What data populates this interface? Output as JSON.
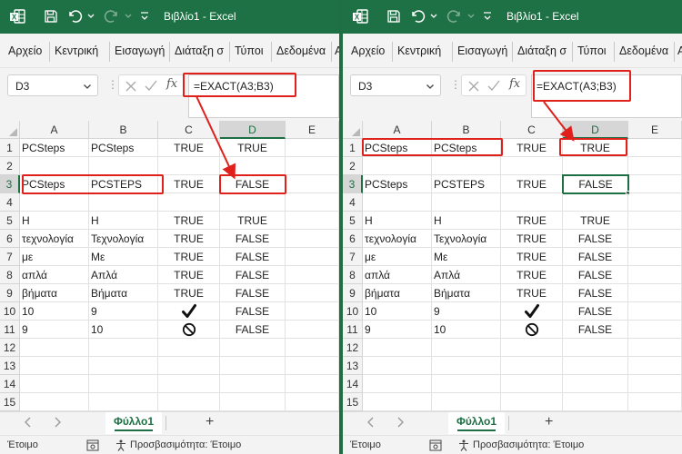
{
  "app": {
    "title": "Βιβλίο1  -  Excel",
    "tabs": [
      "Αρχείο",
      "Κεντρική",
      "Εισαγωγή",
      "Διάταξη σ",
      "Τύποι",
      "Δεδομένα",
      "Α"
    ],
    "name_box": "D3",
    "formula": "=EXACT(A3;B3)",
    "fx_label": "fx",
    "columns": [
      "A",
      "B",
      "C",
      "D",
      "E"
    ],
    "rows": [
      "1",
      "2",
      "3",
      "4",
      "5",
      "6",
      "7",
      "8",
      "9",
      "10",
      "11",
      "12",
      "13",
      "14",
      "15"
    ],
    "sheet_name": "Φύλλο1",
    "add_sheet": "+",
    "status_ready": "Έτοιμο",
    "status_accessibility": "Προσβασιμότητα: Έτοιμο",
    "colors": {
      "excel_green": "#1e7145",
      "highlight_red": "#e0201b"
    }
  },
  "cells": {
    "A1": "PCSteps",
    "B1": "PCSteps",
    "C1": "TRUE",
    "D1": "TRUE",
    "A3": "PCSteps",
    "B3": "PCSTEPS",
    "C3": "TRUE",
    "D3": "FALSE",
    "A5": "Η",
    "B5": "Η",
    "C5": "TRUE",
    "D5": "TRUE",
    "A6": "τεχνολογία",
    "B6": "Τεχνολογία",
    "C6": "TRUE",
    "D6": "FALSE",
    "A7": "με",
    "B7": "Με",
    "C7": "TRUE",
    "D7": "FALSE",
    "A8": "απλά",
    "B8": "Απλά",
    "C8": "TRUE",
    "D8": "FALSE",
    "A9": "βήματα",
    "B9": "Βήματα",
    "C9": "TRUE",
    "D9": "FALSE",
    "A10": "10",
    "B10": "9",
    "C10": "check-icon",
    "D10": "FALSE",
    "A11": "9",
    "B11": "10",
    "C11": "prohibited-icon",
    "D11": "FALSE"
  }
}
